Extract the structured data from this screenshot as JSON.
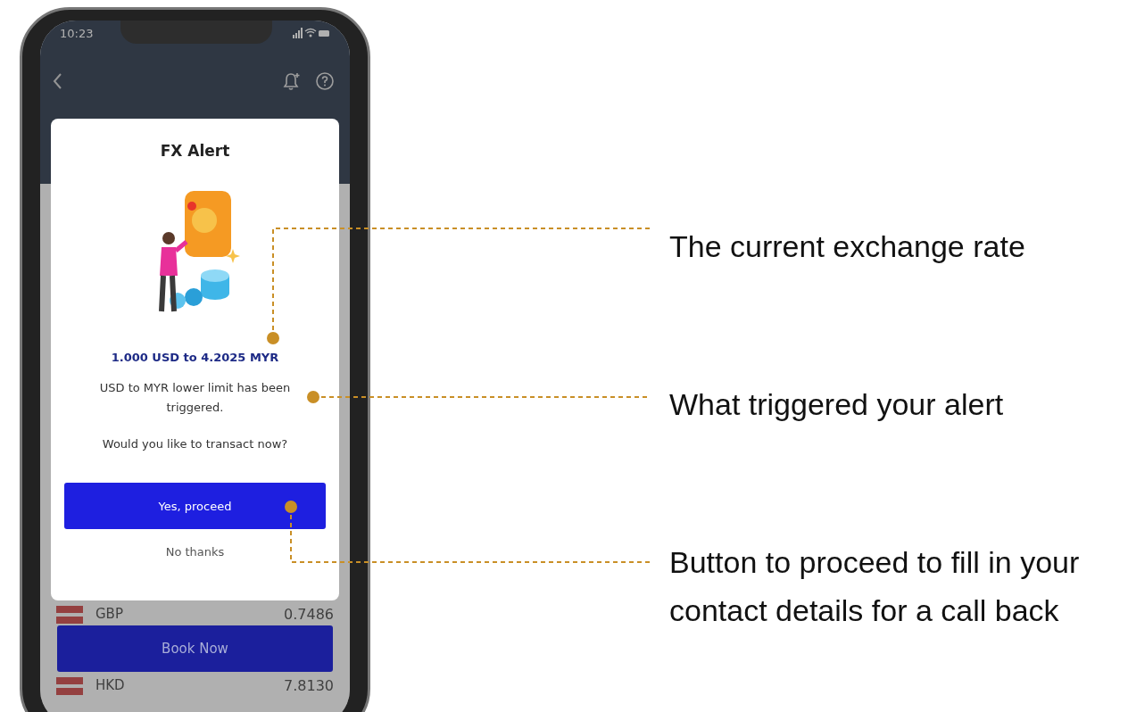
{
  "status_bar": {
    "time": "10:23"
  },
  "modal": {
    "title": "FX Alert",
    "rate": "1.000 USD to 4.2025 MYR",
    "message": "USD to MYR lower limit has been triggered.",
    "question": "Would you like to transact now?",
    "primary_button": "Yes, proceed",
    "secondary_button": "No thanks"
  },
  "rates": [
    {
      "currency": "GBP",
      "rate": "0.7486"
    },
    {
      "currency": "HKD",
      "rate": "7.8130"
    }
  ],
  "book_button": "Book Now",
  "annotations": [
    "The current exchange rate",
    "What triggered your alert",
    "Button to proceed to fill in your contact details for a call back"
  ]
}
